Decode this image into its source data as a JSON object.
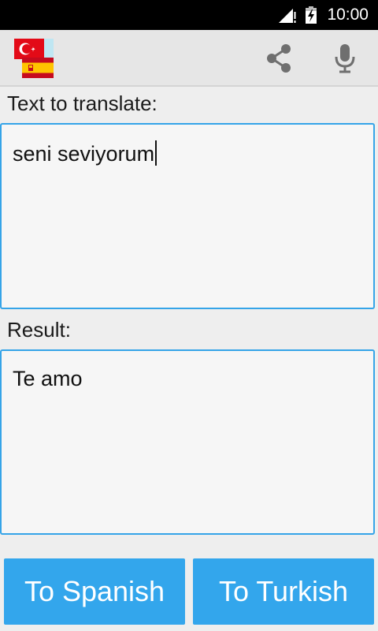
{
  "status_bar": {
    "time": "10:00",
    "icons": [
      "signal-icon",
      "battery-charging-icon"
    ]
  },
  "action_bar": {
    "app_icon": "turkish-spanish-flags-icon",
    "actions": [
      "share-icon",
      "microphone-icon"
    ]
  },
  "input": {
    "label": "Text to translate:",
    "value": "seni seviyorum"
  },
  "result": {
    "label": "Result:",
    "value": "Te amo"
  },
  "buttons": {
    "to_spanish": "To Spanish",
    "to_turkish": "To Turkish"
  },
  "colors": {
    "accent": "#33a6ec",
    "border": "#35a4e8",
    "background": "#eeeeee",
    "status_bar": "#000000"
  }
}
